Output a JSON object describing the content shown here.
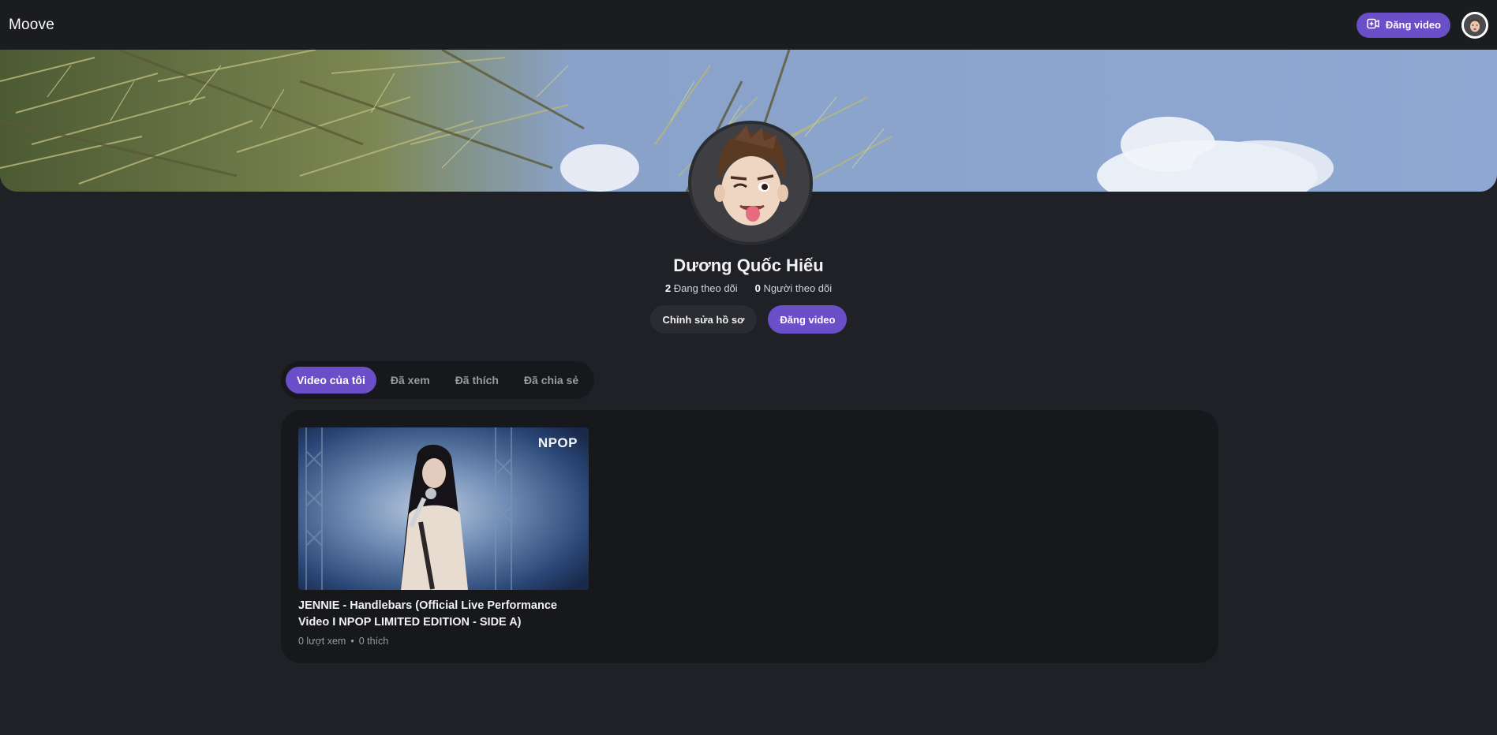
{
  "header": {
    "logo": "Moove",
    "upload_label": "Đăng video",
    "upload_icon": "video-plus-icon",
    "avatar_icon": "user-avatar"
  },
  "profile": {
    "name": "Dương Quốc Hiếu",
    "following_count": "2",
    "following_label": "Đang theo dõi",
    "followers_count": "0",
    "followers_label": "Người theo dõi",
    "edit_label": "Chỉnh sửa hồ sơ",
    "upload_label": "Đăng video"
  },
  "tabs": [
    {
      "label": "Video của tôi",
      "active": true
    },
    {
      "label": "Đã xem",
      "active": false
    },
    {
      "label": "Đã thích",
      "active": false
    },
    {
      "label": "Đã chia sẻ",
      "active": false
    }
  ],
  "videos": [
    {
      "thumbnail_logo": "NPOP",
      "title": "JENNIE - Handlebars (Official Live Performance Video I NPOP LIMITED EDITION - SIDE A)",
      "views": "0 lượt xem",
      "separator": "•",
      "likes": "0 thích"
    }
  ],
  "colors": {
    "accent": "#6b4fc9",
    "background": "#1f2126",
    "panel": "#17181b",
    "topbar": "#1b1c1f"
  }
}
